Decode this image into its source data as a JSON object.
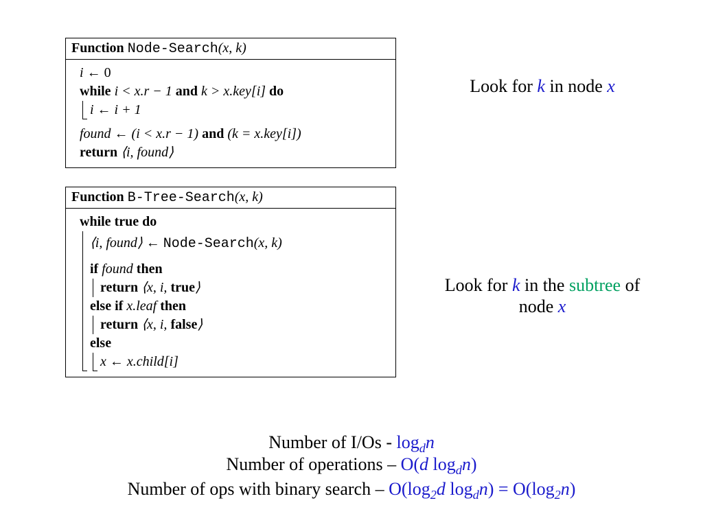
{
  "algo1": {
    "title_kw": "Function",
    "title_fn": "Node-Search",
    "title_args": "(x, k)",
    "l1_i": "i",
    "l1_arrow": " ← ",
    "l1_zero": "0",
    "l2_while": "while",
    "l2_cond1": " i < x.r − 1 ",
    "l2_and": "and",
    "l2_cond2": " k > x.key[i] ",
    "l2_do": "do",
    "l3_body": "i ← i + 1",
    "l4_assign": "found ← (i < x.r − 1) ",
    "l4_and": "and",
    "l4_tail": " (k = x.key[i])",
    "l5_ret": "return",
    "l5_val": " ⟨i, found⟩"
  },
  "algo2": {
    "title_kw": "Function",
    "title_fn": "B-Tree-Search",
    "title_args": "(x, k)",
    "l1_while": "while",
    "l1_true": " true ",
    "l1_do": "do",
    "l2_lhs": "⟨i, found⟩ ← ",
    "l2_fn": "Node-Search",
    "l2_args": "(x, k)",
    "l3_if": "if",
    "l3_cond": " found ",
    "l3_then": "then",
    "l4_ret": "return",
    "l4_val": " ⟨x, i, ",
    "l4_true": "true",
    "l4_close": "⟩",
    "l5_elseif": "else if",
    "l5_cond": " x.leaf ",
    "l5_then": "then",
    "l6_ret": "return",
    "l6_val": " ⟨x, i, ",
    "l6_false": "false",
    "l6_close": "⟩",
    "l7_else": "else",
    "l8_body": "x ← x.child[i]"
  },
  "annot1": {
    "pre": "Look for ",
    "k": "k",
    "mid": " in node ",
    "x": "x"
  },
  "annot2": {
    "pre": "Look for ",
    "k": "k",
    "mid": " in the ",
    "subtree": "subtree",
    "mid2": " of node ",
    "x": "x"
  },
  "bottom": {
    "l1_a": "Number of I/Os - ",
    "l1_b": "log",
    "l1_sub": "d",
    "l1_c": "n",
    "l2_a": "Number of operations – ",
    "l2_b": "O(",
    "l2_d": "d",
    "l2_log": " log",
    "l2_sub": "d",
    "l2_n": "n",
    "l2_close": ")",
    "l3_a": "Number of ops with binary search – ",
    "l3_b": "O(log",
    "l3_sub1": "2",
    "l3_d": "d",
    "l3_log": " log",
    "l3_sub2": "d",
    "l3_n": "n",
    "l3_mid": ") = O(log",
    "l3_sub3": "2",
    "l3_n2": "n",
    "l3_close": ")"
  }
}
